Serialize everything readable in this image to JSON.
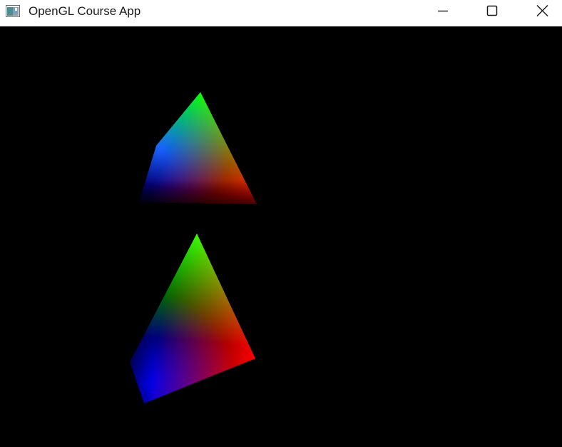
{
  "window": {
    "title": "OpenGL Course App",
    "icon": "application-window-icon",
    "controls": {
      "minimize_icon": "minimize-icon",
      "maximize_icon": "maximize-icon",
      "close_icon": "close-icon"
    }
  },
  "scene": {
    "background": "#000000",
    "objects": [
      {
        "name": "pyramid-top",
        "vertex_colors": [
          "#00ff00",
          "#ff0000",
          "#0000ff"
        ]
      },
      {
        "name": "pyramid-bottom",
        "vertex_colors": [
          "#00ff00",
          "#ff0000",
          "#0000ff"
        ]
      }
    ]
  }
}
